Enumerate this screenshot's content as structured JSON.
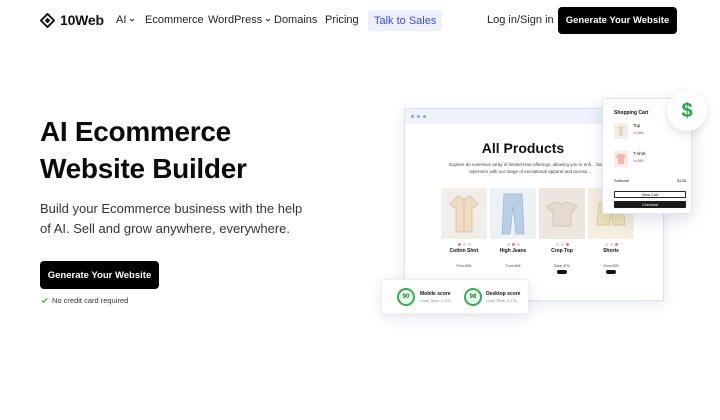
{
  "nav": {
    "logo_text": "10Web",
    "items": [
      {
        "label": "AI",
        "dropdown": true
      },
      {
        "label": "Ecommerce",
        "dropdown": false
      },
      {
        "label": "WordPress",
        "dropdown": true
      },
      {
        "label": "Domains",
        "dropdown": false
      },
      {
        "label": "Pricing",
        "dropdown": false
      }
    ],
    "talk_to_sales": "Talk to Sales",
    "login": "Log in/Sign in",
    "cta": "Generate Your Website"
  },
  "hero": {
    "title_line1": "AI Ecommerce",
    "title_line2": "Website Builder",
    "subtitle": "Build your Ecommerce business with the help of AI. Sell and grow anywhere, everywhere.",
    "cta": "Generate Your Website",
    "note": "No credit card required"
  },
  "mockup": {
    "title": "All Products",
    "description": "Explore an extensive array of limited-time offerings, allowing you to enh... fashion repertoire with our range of exceptional apparel and access...",
    "products": [
      {
        "name": "Cotton Shirt",
        "label": "New",
        "price": "From $39"
      },
      {
        "name": "High Jeans",
        "label": "New",
        "price": "From $49"
      },
      {
        "name": "Crop Top",
        "label": "New",
        "price": "Save 47%"
      },
      {
        "name": "Shorts",
        "label": "New",
        "price": "From $29"
      }
    ],
    "cart": {
      "title": "Shopping Cart",
      "items": [
        {
          "name": "Top",
          "meta": "1x $46"
        },
        {
          "name": "T-shirt",
          "meta": "1x $69"
        }
      ],
      "subtotal_label": "Subtotal",
      "subtotal_value": "$138",
      "view_cart": "View Cart",
      "checkout": "Checkout"
    },
    "scores": [
      {
        "value": "90",
        "label": "Mobile score",
        "meta": "Load Time: 2.17s"
      },
      {
        "value": "98",
        "label": "Desktop score",
        "meta": "Load Time: 2.17s"
      }
    ]
  },
  "colors": {
    "accent": "#3a4ce0",
    "talk_bg": "#eef0fd",
    "success": "#2fb24f",
    "dark": "#000000"
  }
}
